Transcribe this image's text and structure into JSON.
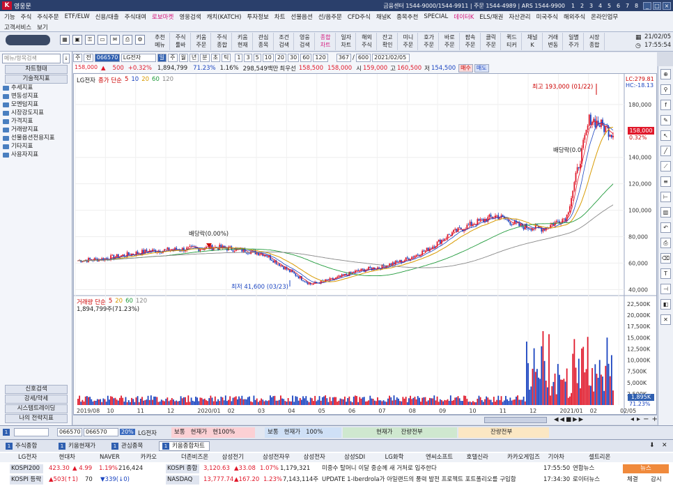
{
  "titlebar": {
    "appname": "영웅문",
    "contact": "금융센터 1544-9000/1544-9911 | 주문 1544-4989 | ARS 1544-9900",
    "win_nums": [
      "1",
      "2",
      "3",
      "4",
      "5",
      "6",
      "7",
      "8"
    ]
  },
  "menu": {
    "row1": [
      "기능",
      "주식",
      "주식주문",
      "ETF/ELW",
      "신용/대출",
      "주식대여",
      "로보마켓",
      "영웅검색",
      "캐치(KATCH)",
      "투자정보",
      "차트",
      "선물옵션",
      "선/옵주문",
      "CFD주식",
      "채널K",
      "종목추천",
      "SPECIAL",
      "데이터K",
      "ELS/채권",
      "자산관리",
      "미국주식",
      "해외주식",
      "온라인업무"
    ],
    "row2": [
      "고객서비스",
      "보기"
    ]
  },
  "toolbar": {
    "buttons": [
      [
        "추천",
        "메뉴"
      ],
      [
        "주식",
        "툴바"
      ],
      [
        "키움",
        "주문"
      ],
      [
        "주식",
        "종합"
      ],
      [
        "키움",
        "현재"
      ],
      [
        "관심",
        "종목"
      ],
      [
        "조건",
        "검색"
      ],
      [
        "영웅",
        "검색"
      ],
      [
        "종합",
        "차트"
      ],
      [
        "일자",
        "차트"
      ],
      [
        "해외",
        "주식"
      ],
      [
        "잔고",
        "확인"
      ],
      [
        "미니",
        "주문"
      ],
      [
        "호가",
        "주문"
      ],
      [
        "바로",
        "주문"
      ],
      [
        "팝속",
        "주문"
      ],
      [
        "클릭",
        "주문"
      ],
      [
        "퀵드",
        "티커"
      ],
      [
        "채널",
        "K"
      ],
      [
        "거래",
        "변동"
      ],
      [
        "일별",
        "주가"
      ],
      [
        "시장",
        "종합"
      ]
    ],
    "date": "21/02/05",
    "time": "17:55:54"
  },
  "leftpanel": {
    "search_placeholder": "메뉴/항목검색",
    "header_btn": "차트형태",
    "tech_btn": "기술적지표",
    "tree": [
      "추세지표",
      "변동성지표",
      "모멘텀지표",
      "시장강도지표",
      "가격지표",
      "거래량지표",
      "선물옵션전용지표",
      "기타지표",
      "사용자지표"
    ],
    "bottom_btns": [
      "신호검색",
      "강세/약세",
      "시스템트레이딩",
      "나의 전략지표"
    ]
  },
  "charttoolbar": {
    "type_btns": [
      "주",
      "전"
    ],
    "code": "066570",
    "name": "LG전자",
    "period_btns": [
      "일",
      "주",
      "월",
      "년",
      "분",
      "초",
      "틱"
    ],
    "nums": [
      "1",
      "3",
      "5",
      "10",
      "20",
      "30",
      "60",
      "120"
    ],
    "count": "367",
    "total": "600",
    "date": "2021/02/05",
    "price": "158,000",
    "change": "▲",
    "diff": "500",
    "rate": "+0.32%",
    "volume": "1,894,799",
    "vol_rate": "71.23%",
    "ratio": "1.16%",
    "amount": "298,549백만",
    "pref_label": "최우선",
    "ask": "158,500",
    "bid": "158,000",
    "open_label": "시",
    "open": "159,000",
    "high_label": "고",
    "high": "160,500",
    "low_label": "저",
    "low": "154,500",
    "buy": "매수",
    "sell": "매도"
  },
  "chart": {
    "price_legend": "LG전자",
    "ma_legend": [
      "종가 단순",
      "5",
      "10",
      "20",
      "60",
      "120"
    ],
    "vol_legend": [
      "거래량 단순",
      "5",
      "20",
      "60",
      "120"
    ],
    "vol_current": "1,894,799주(71.23%)",
    "annot_high": "최고 193,000 (01/22)",
    "annot_low": "최저 41,600 (03/23)",
    "annot_div1": "배당락(0.00%)",
    "annot_div2": "배당락(0.0",
    "lc": "LC:279.81",
    "hc": "HC:-18.13",
    "cur_price": "158,000",
    "cur_pct": "0.32%",
    "vol_price_label": "1,895K",
    "vol_pct": "71.23%"
  },
  "chart_data": {
    "type": "line",
    "title": "",
    "y_ticks": [
      40000,
      60000,
      80000,
      100000,
      120000,
      140000,
      160000,
      180000
    ],
    "vol_ticks": [
      "2,500K",
      "5,000K",
      "7,500K",
      "10,000K",
      "12,500K",
      "15,000K",
      "17,500K",
      "20,000K",
      "22,500K"
    ],
    "x_labels": [
      "2019/08",
      "10",
      "11",
      "12",
      "2020/01",
      "02",
      "03",
      "04",
      "05",
      "06",
      "07",
      "08",
      "09",
      "10",
      "11",
      "12",
      "2021/01",
      "02",
      "02/05"
    ],
    "close": [
      62000,
      63000,
      66000,
      69000,
      70000,
      71000,
      72000,
      70000,
      67000,
      55000,
      44000,
      48000,
      54000,
      57000,
      62000,
      70000,
      82000,
      90000,
      96000,
      88000,
      86000,
      95000,
      170000,
      158000
    ]
  },
  "bottompanel": {
    "code_input": "066570",
    "pct": "20%",
    "name": "LG전자",
    "label1": "보통",
    "label2": "현재가",
    "label3": "현100%",
    "label4": "보통",
    "label5": "현재가",
    "label6": "100%",
    "label7": "현재가",
    "label8": "잔량전부",
    "label9": "잔량전부"
  },
  "tabs": [
    "주식종합",
    "키움현재가",
    "관심종목",
    "키움종합차트"
  ],
  "stocks": {
    "row1": [
      "LG전자",
      "현대차",
      "NAVER",
      "카카오",
      "더존비즈온",
      "삼성전기",
      "삼성전자우",
      "삼성전자",
      "삼성SDI",
      "LG화학",
      "엔씨소프트",
      "호텔신라",
      "카카오게임즈",
      "기아차",
      "셀트리온"
    ],
    "row2": {
      "name": "KOSPI200",
      "val": "423.30",
      "chg": "▲ 4.99",
      "pct": "1.19%",
      "vol": "216,424",
      "idx": "KOSPI 종합",
      "idx_val": "3,120.63",
      "idx_chg": "▲33.08",
      "idx_pct": "1.07%",
      "idx_vol": "1,179,321",
      "news": "미중수 탈머니 이달 중순께 새 거처로 입주한다",
      "time": "17:55:50",
      "src": "연합뉴스",
      "btn": "뉴스"
    },
    "row3": {
      "name": "KOSPI 등락",
      "up": "▲503(↑1)",
      "same": "70",
      "down": "▼339(↓0)",
      "idx": "NASDAQ",
      "idx_val": "13,777.74",
      "idx_chg": "▲167.20",
      "idx_pct": "1.23%",
      "idx_vol": "7,143,114주",
      "news": "UPDATE 1-Iberdrola가 아일랜드의 풍력 발전 프로젝트 포트폴리오를 구입함",
      "time": "17:34:30",
      "src": "로이터뉴스",
      "b1": "체결",
      "b2": "감시"
    }
  }
}
